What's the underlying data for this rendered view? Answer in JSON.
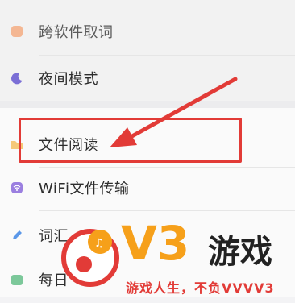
{
  "menu": {
    "items": [
      {
        "label": "跨软件取词",
        "icon": "cross-app-lookup-icon",
        "color": "#f4a77a"
      },
      {
        "label": "夜间模式",
        "icon": "moon-icon",
        "color": "#7b6fd6"
      },
      {
        "label": "文件阅读",
        "icon": "folder-icon",
        "color": "#f5c978"
      },
      {
        "label": "WiFi文件传输",
        "icon": "wifi-transfer-icon",
        "color": "#9b7fe0"
      },
      {
        "label": "词汇",
        "icon": "pen-icon",
        "color": "#5b97e8"
      },
      {
        "label": "每日",
        "icon": "daily-icon",
        "color": "#7cc89a"
      }
    ]
  },
  "annotation": {
    "highlight_color": "#e23b37"
  },
  "watermark": {
    "brand": "V3",
    "brand_suffix": "游戏",
    "slogan": "游戏人生，不负VVVV3",
    "accent": "#f6a01a"
  }
}
